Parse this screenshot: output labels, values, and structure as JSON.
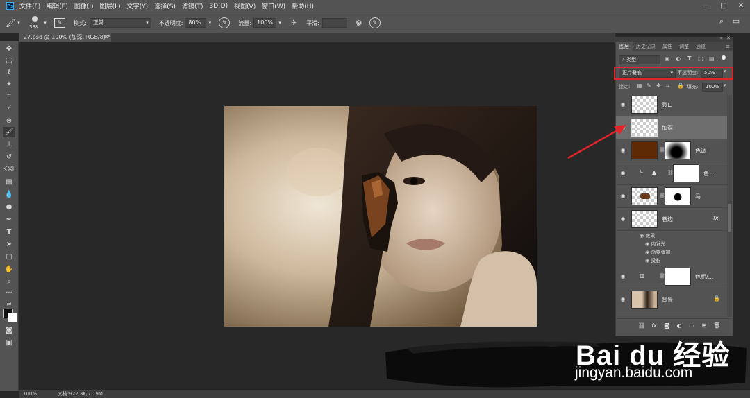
{
  "menubar": {
    "logo": "Ps",
    "items": [
      "文件(F)",
      "编辑(E)",
      "图像(I)",
      "图层(L)",
      "文字(Y)",
      "选择(S)",
      "滤镜(T)",
      "3D(D)",
      "视图(V)",
      "窗口(W)",
      "帮助(H)"
    ],
    "window_controls": [
      "—",
      "□",
      "✕"
    ]
  },
  "options": {
    "brush_size": "338",
    "mode_label": "模式:",
    "mode_value": "正常",
    "opacity_label": "不透明度:",
    "opacity_value": "80%",
    "flow_label": "流量:",
    "flow_value": "100%",
    "smoothing_label": "平滑:",
    "smoothing_value": ""
  },
  "document": {
    "tab_title": "27.psd @ 100% (加深, RGB/8) *"
  },
  "statusbar": {
    "zoom": "100%",
    "doc_info": "文档:922.3K/7.19M"
  },
  "panel": {
    "tabs": [
      "图层",
      "历史记录",
      "属性",
      "调整",
      "通道"
    ],
    "active_tab": 0,
    "filter_kind": "类型",
    "blend_mode": "正片叠底",
    "opacity_label": "不透明度:",
    "opacity_value": "50%",
    "lock_label": "锁定:",
    "fill_label": "填充:",
    "fill_value": "100%",
    "layers": [
      {
        "name": "裂口",
        "selected": false
      },
      {
        "name": "加深",
        "selected": true
      },
      {
        "name": "色调",
        "selected": false
      },
      {
        "name": "色...",
        "selected": false
      },
      {
        "name": "马",
        "selected": false
      },
      {
        "name": "卷边",
        "selected": false,
        "fx": "fx"
      },
      {
        "name": "色相/...",
        "selected": false
      },
      {
        "name": "背景",
        "selected": false
      }
    ],
    "effects": {
      "title": "效果",
      "items": [
        "内发光",
        "渐变叠加",
        "投影"
      ]
    }
  },
  "watermark": {
    "logo": "Bai du 经验",
    "url": "jingyan.baidu.com"
  },
  "colors": {
    "highlight": "#e0242a",
    "ui_gray": "#535353",
    "canvas_bg": "#282828",
    "selected_layer": "#6e6e6e"
  }
}
